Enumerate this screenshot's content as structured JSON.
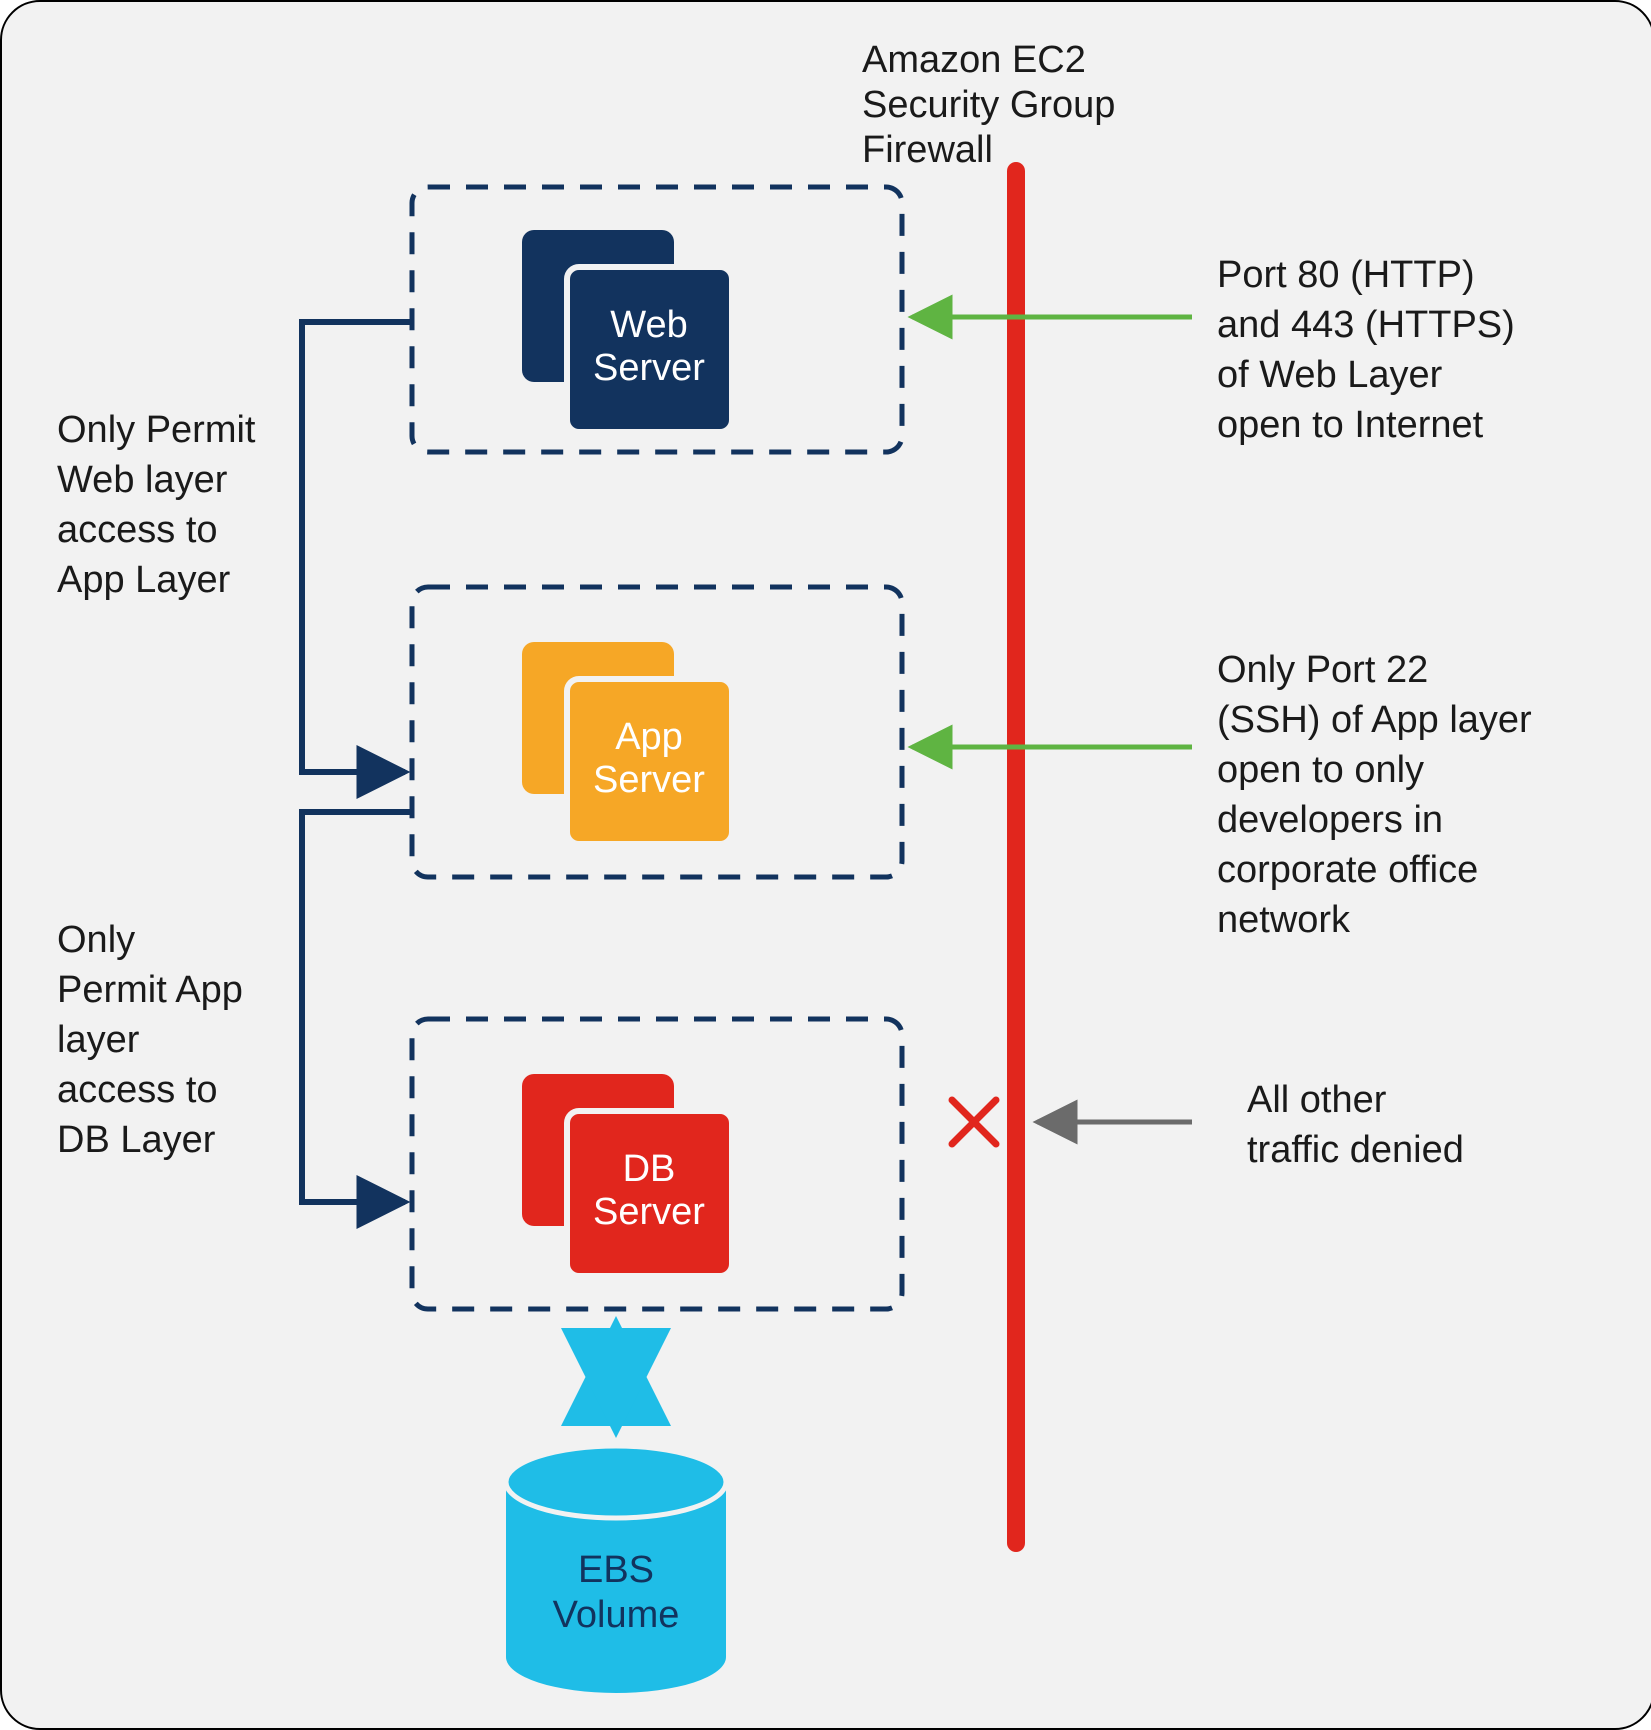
{
  "title": {
    "line1": "Amazon EC2",
    "line2": "Security Group",
    "line3": "Firewall"
  },
  "layers": {
    "web": {
      "label_line1": "Web",
      "label_line2": "Server"
    },
    "app": {
      "label_line1": "App",
      "label_line2": "Server"
    },
    "db": {
      "label_line1": "DB",
      "label_line2": "Server"
    }
  },
  "storage": {
    "label_line1": "EBS",
    "label_line2": "Volume"
  },
  "left_notes": {
    "web_to_app": {
      "l1": "Only Permit",
      "l2": "Web layer",
      "l3": "access to",
      "l4": "App Layer"
    },
    "app_to_db": {
      "l1": "Only",
      "l2": "Permit App",
      "l3": "layer",
      "l4": "access to",
      "l5": "DB Layer"
    }
  },
  "right_notes": {
    "web_open": {
      "l1": "Port 80 (HTTP)",
      "l2": "and 443 (HTTPS)",
      "l3": "of Web Layer",
      "l4": "open to Internet"
    },
    "app_ssh": {
      "l1": "Only Port 22",
      "l2": "(SSH) of App layer",
      "l3": "open to only",
      "l4": "developers in",
      "l5": "corporate office",
      "l6": "network"
    },
    "denied": {
      "l1": "All other",
      "l2": "traffic denied"
    }
  },
  "colors": {
    "navy": "#12335e",
    "orange": "#f6a726",
    "red": "#e1261d",
    "cyan": "#1fbde7",
    "green": "#5fb442",
    "grey": "#6b6b6b",
    "firewall": "#e1261d"
  }
}
